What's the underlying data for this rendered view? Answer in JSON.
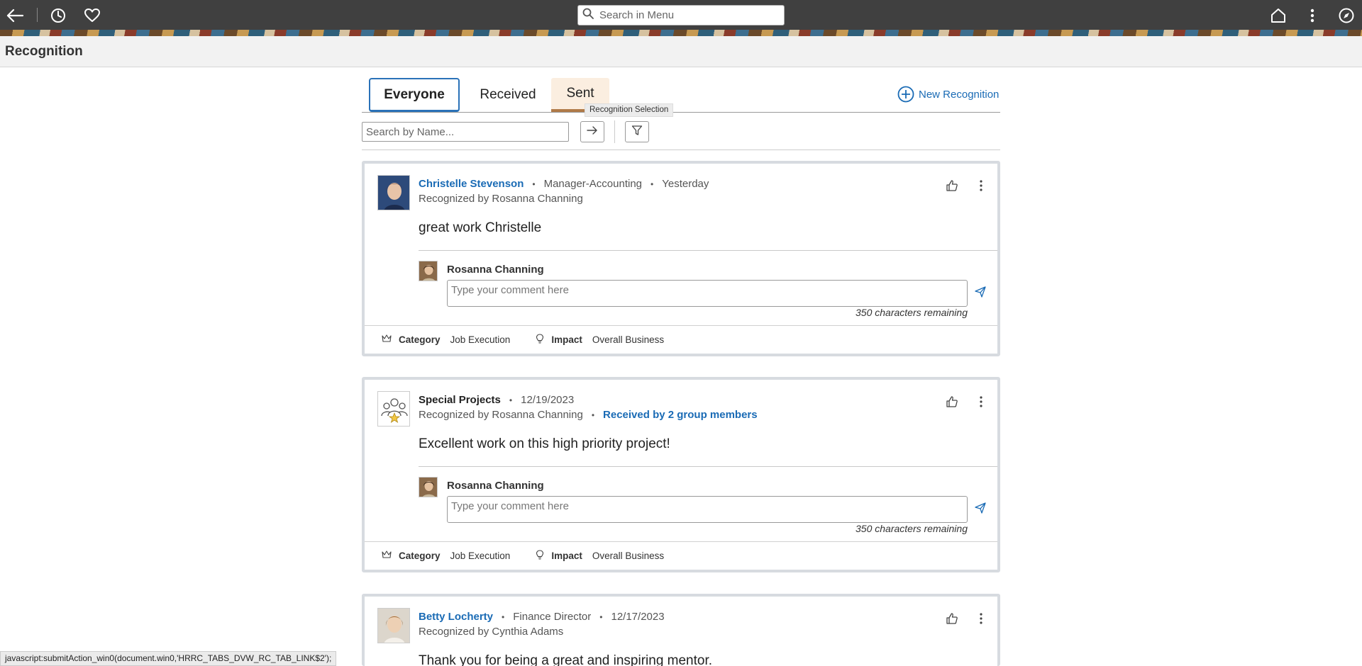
{
  "topbar": {
    "back_icon": "back-arrow-icon",
    "history_icon": "clock-icon",
    "favorites_icon": "heart-icon",
    "search_placeholder": "Search in Menu",
    "home_icon": "home-icon",
    "actions_icon": "vertical-ellipsis-icon",
    "navigator_icon": "compass-icon"
  },
  "page": {
    "title": "Recognition"
  },
  "tabs": [
    {
      "label": "Everyone",
      "selected": true
    },
    {
      "label": "Received",
      "selected": false
    },
    {
      "label": "Sent",
      "selected": false
    }
  ],
  "tooltip": "Recognition Selection",
  "new_recognition_label": "New Recognition",
  "filter": {
    "search_placeholder": "Search by Name..."
  },
  "cards": [
    {
      "name": "Christelle Stevenson",
      "title": "Manager-Accounting",
      "date": "Yesterday",
      "recognized_by": "Recognized by Rosanna Channing",
      "message": "great work Christelle",
      "commenter": "Rosanna Channing",
      "comment_placeholder": "Type your comment here",
      "chars_remaining": "350 characters remaining",
      "category_label": "Category",
      "category": "Job Execution",
      "impact_label": "Impact",
      "impact": "Overall Business"
    },
    {
      "name": "Special Projects",
      "date": "12/19/2023",
      "recognized_by": "Recognized by Rosanna Channing",
      "received_by": "Received by 2 group members",
      "message": "Excellent work on this high priority project!",
      "commenter": "Rosanna Channing",
      "comment_placeholder": "Type your comment here",
      "chars_remaining": "350 characters remaining",
      "category_label": "Category",
      "category": "Job Execution",
      "impact_label": "Impact",
      "impact": "Overall Business"
    },
    {
      "name": "Betty Locherty",
      "title": "Finance Director",
      "date": "12/17/2023",
      "recognized_by": "Recognized by Cynthia Adams",
      "message": "Thank you for being a great and inspiring mentor."
    }
  ],
  "status_bar": "javascript:submitAction_win0(document.win0,'HRRC_TABS_DVW_RC_TAB_LINK$2');",
  "colors": {
    "link": "#1a6bb5",
    "topbar": "#404040",
    "tab_selected": "#2a72b8",
    "tab_hover": "#fbeee0"
  }
}
